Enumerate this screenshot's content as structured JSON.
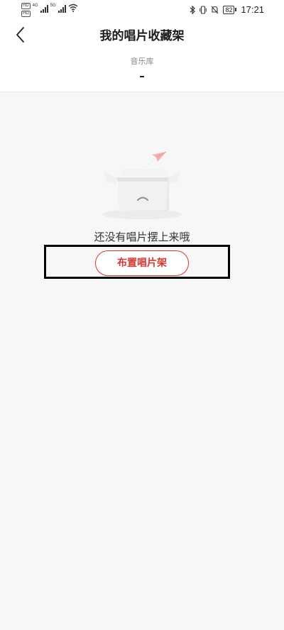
{
  "status_bar": {
    "hd_labels": [
      "HD",
      "HD"
    ],
    "network_1": "4G",
    "network_2": "5G",
    "battery": "82",
    "time": "17:21"
  },
  "header": {
    "title": "我的唱片收藏架"
  },
  "tabs": [
    {
      "label": "音乐库",
      "active": true
    }
  ],
  "empty_state": {
    "message": "还没有唱片摆上来哦",
    "button_label": "布置唱片架"
  },
  "colors": {
    "accent": "#d33a31",
    "background": "#f7f7f7",
    "highlight_border": "#000000"
  }
}
